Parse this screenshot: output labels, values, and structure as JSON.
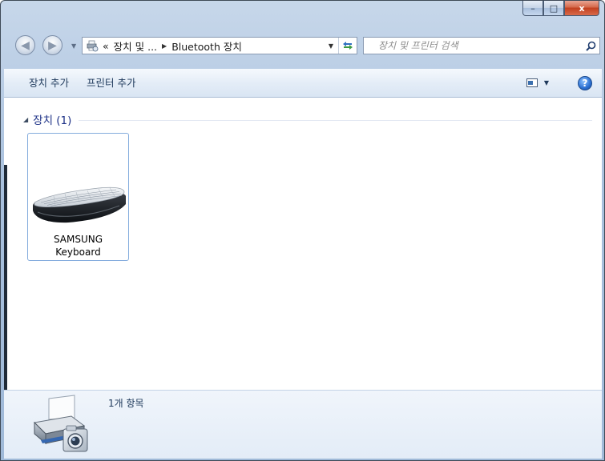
{
  "window": {
    "caption_buttons": {
      "minimize": "–",
      "maximize": "□",
      "close": "x"
    }
  },
  "nav": {
    "back_glyph": "◀",
    "forward_glyph": "▶",
    "address": {
      "overflow": "«",
      "segments": [
        "장치 및 ...",
        "Bluetooth 장치"
      ],
      "separator": "▶",
      "dropdown": "▼"
    },
    "search": {
      "placeholder": "장치 및 프린터 검색"
    }
  },
  "toolbar": {
    "add_device": "장치 추가",
    "add_printer": "프린터 추가",
    "view_dropdown": "▼",
    "help": "?"
  },
  "content": {
    "group": {
      "expander": "◢",
      "title": "장치 (1)"
    },
    "devices": [
      {
        "name_line1": "SAMSUNG",
        "name_line2": "Keyboard",
        "icon": "keyboard-icon"
      }
    ]
  },
  "details_pane": {
    "item_count": "1개 항목",
    "icon": "devices-printers-icon"
  },
  "colors": {
    "accent_title": "#1e3287",
    "toolbar_text": "#1e395b",
    "selection_border": "#84acdd",
    "close_button": "#c2401f"
  }
}
